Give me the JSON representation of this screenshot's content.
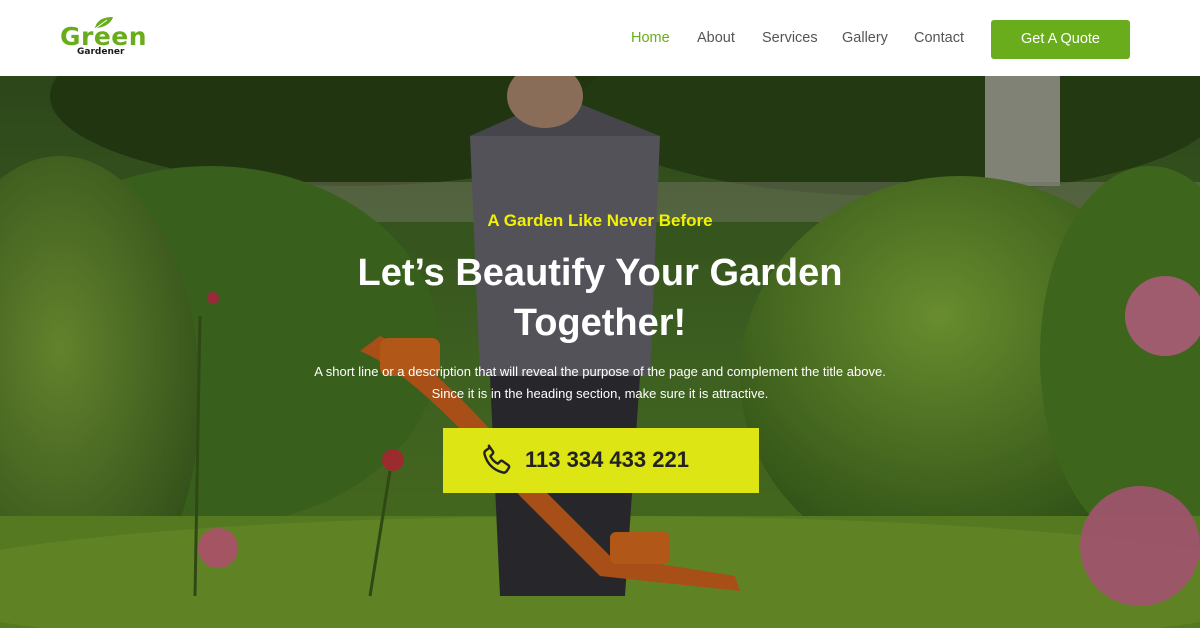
{
  "brand": {
    "name": "Green",
    "tagline": "Gardener",
    "color": "#6aad1c"
  },
  "nav": {
    "items": [
      {
        "label": "Home",
        "active": true
      },
      {
        "label": "About",
        "active": false
      },
      {
        "label": "Services",
        "active": false
      },
      {
        "label": "Gallery",
        "active": false
      },
      {
        "label": "Contact",
        "active": false
      }
    ],
    "cta_label": "Get A Quote"
  },
  "hero": {
    "eyebrow": "A Garden Like Never Before",
    "title_line1": "Let’s Beautify Your Garden",
    "title_line2": "Together!",
    "desc_line1": "A short line or a description that will reveal the purpose of the page and complement the title above.",
    "desc_line2": "Since it is in the heading section, make sure it is attractive.",
    "phone": "113 334 433 221",
    "phone_icon": "phone-icon",
    "accent_color": "#dde515"
  }
}
